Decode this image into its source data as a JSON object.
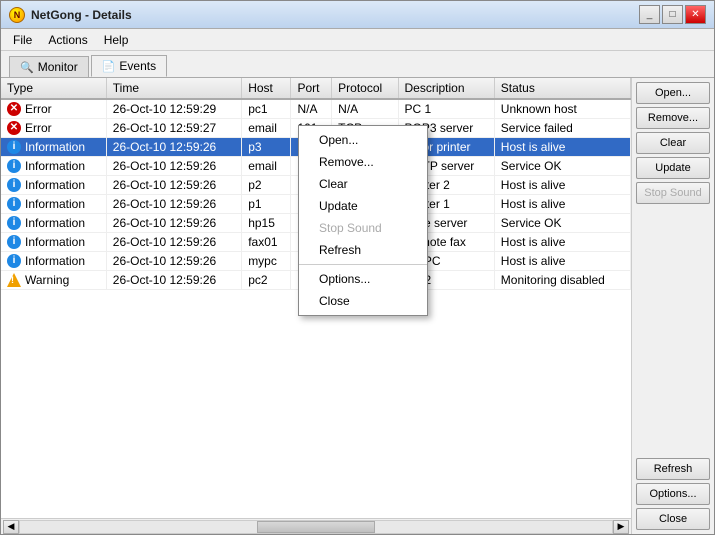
{
  "window": {
    "title": "NetGong - Details",
    "titleButtons": [
      "_",
      "□",
      "✕"
    ]
  },
  "menu": {
    "items": [
      "File",
      "Actions",
      "Help"
    ]
  },
  "tabs": [
    {
      "id": "monitor",
      "label": "Monitor",
      "icon": "🔍",
      "active": false
    },
    {
      "id": "events",
      "label": "Events",
      "icon": "📄",
      "active": true
    }
  ],
  "table": {
    "columns": [
      "Type",
      "Time",
      "Host",
      "Port",
      "Protocol",
      "Description",
      "Status"
    ],
    "rows": [
      {
        "type": "Error",
        "typeIcon": "error",
        "time": "26-Oct-10 12:59:29",
        "host": "pc1",
        "port": "N/A",
        "protocol": "N/A",
        "description": "PC 1",
        "status": "Unknown host",
        "selected": false
      },
      {
        "type": "Error",
        "typeIcon": "error",
        "time": "26-Oct-10 12:59:27",
        "host": "email",
        "port": "101",
        "protocol": "TCP",
        "description": "POP3 server",
        "status": "Service failed",
        "selected": false
      },
      {
        "type": "Information",
        "typeIcon": "info",
        "time": "26-Oct-10 12:59:26",
        "host": "p3",
        "port": "",
        "protocol": "",
        "description": "Color printer",
        "status": "Host is alive",
        "selected": true
      },
      {
        "type": "Information",
        "typeIcon": "info",
        "time": "26-Oct-10 12:59:26",
        "host": "email",
        "port": "",
        "protocol": "",
        "description": "SMTP server",
        "status": "Service OK",
        "selected": false
      },
      {
        "type": "Information",
        "typeIcon": "info",
        "time": "26-Oct-10 12:59:26",
        "host": "p2",
        "port": "",
        "protocol": "",
        "description": "Printer 2",
        "status": "Host is alive",
        "selected": false
      },
      {
        "type": "Information",
        "typeIcon": "info",
        "time": "26-Oct-10 12:59:26",
        "host": "p1",
        "port": "",
        "protocol": "",
        "description": "Printer 1",
        "status": "Host is alive",
        "selected": false
      },
      {
        "type": "Information",
        "typeIcon": "info",
        "time": "26-Oct-10 12:59:26",
        "host": "hp15",
        "port": "",
        "protocol": "",
        "description": "Time server",
        "status": "Service OK",
        "selected": false
      },
      {
        "type": "Information",
        "typeIcon": "info",
        "time": "26-Oct-10 12:59:26",
        "host": "fax01",
        "port": "",
        "protocol": "",
        "description": "Remote fax",
        "status": "Host is alive",
        "selected": false
      },
      {
        "type": "Information",
        "typeIcon": "info",
        "time": "26-Oct-10 12:59:26",
        "host": "mypc",
        "port": "",
        "protocol": "",
        "description": "My PC",
        "status": "Host is alive",
        "selected": false
      },
      {
        "type": "Warning",
        "typeIcon": "warning",
        "time": "26-Oct-10 12:59:26",
        "host": "pc2",
        "port": "",
        "protocol": "",
        "description": "PC 2",
        "status": "Monitoring disabled",
        "selected": false
      }
    ]
  },
  "sidebar": {
    "buttons": [
      {
        "id": "open",
        "label": "Open...",
        "disabled": false
      },
      {
        "id": "remove",
        "label": "Remove...",
        "disabled": false
      },
      {
        "id": "clear",
        "label": "Clear",
        "disabled": false
      },
      {
        "id": "update",
        "label": "Update",
        "disabled": false
      },
      {
        "id": "stop-sound",
        "label": "Stop Sound",
        "disabled": true
      }
    ],
    "bottomButtons": [
      {
        "id": "refresh",
        "label": "Refresh",
        "disabled": false
      },
      {
        "id": "options",
        "label": "Options...",
        "disabled": false
      },
      {
        "id": "close",
        "label": "Close",
        "disabled": false
      }
    ]
  },
  "contextMenu": {
    "items": [
      {
        "id": "ctx-open",
        "label": "Open...",
        "disabled": false
      },
      {
        "id": "ctx-remove",
        "label": "Remove...",
        "disabled": false
      },
      {
        "id": "ctx-clear",
        "label": "Clear",
        "disabled": false
      },
      {
        "id": "ctx-update",
        "label": "Update",
        "disabled": false
      },
      {
        "id": "ctx-stop-sound",
        "label": "Stop Sound",
        "disabled": true
      },
      {
        "id": "ctx-refresh",
        "label": "Refresh",
        "disabled": false
      },
      {
        "id": "separator",
        "label": "",
        "separator": true
      },
      {
        "id": "ctx-options",
        "label": "Options...",
        "disabled": false
      },
      {
        "id": "ctx-close",
        "label": "Close",
        "disabled": false
      }
    ]
  }
}
